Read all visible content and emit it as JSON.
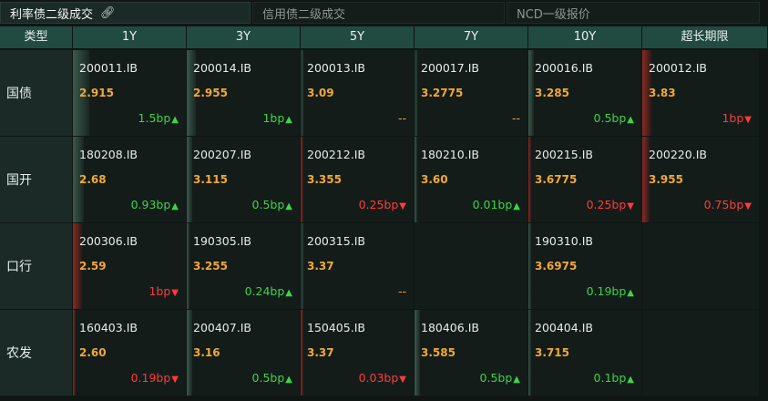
{
  "tabs": [
    {
      "label": "利率债二级成交",
      "active": true,
      "icon": "link-icon"
    },
    {
      "label": "信用债二级成交",
      "active": false
    },
    {
      "label": "NCD一级报价",
      "active": false
    }
  ],
  "columns": [
    "类型",
    "1Y",
    "3Y",
    "5Y",
    "7Y",
    "10Y",
    "超长期限"
  ],
  "colors": {
    "up": "#3ed34a",
    "down": "#ff3b3b",
    "yield": "#f0a93a",
    "header": "#214a40"
  },
  "rows": [
    {
      "label": "国债",
      "cells": [
        {
          "code": "200011.IB",
          "yield": "2.915",
          "change": "1.5bp",
          "dir": "up",
          "level": 0.45
        },
        {
          "code": "200014.IB",
          "yield": "2.955",
          "change": "1bp",
          "dir": "up",
          "level": 0.25
        },
        {
          "code": "200013.IB",
          "yield": "3.09",
          "change": "--",
          "dir": "flat",
          "level": 0
        },
        {
          "code": "200017.IB",
          "yield": "3.2775",
          "change": "--",
          "dir": "flat",
          "level": 0
        },
        {
          "code": "200016.IB",
          "yield": "3.285",
          "change": "0.5bp",
          "dir": "up",
          "level": 0.15
        },
        {
          "code": "200012.IB",
          "yield": "3.83",
          "change": "1bp",
          "dir": "down",
          "level": 0.25
        }
      ]
    },
    {
      "label": "国开",
      "cells": [
        {
          "code": "180208.IB",
          "yield": "2.68",
          "change": "0.93bp",
          "dir": "up",
          "level": 0.3
        },
        {
          "code": "200207.IB",
          "yield": "3.115",
          "change": "0.5bp",
          "dir": "up",
          "level": 0.15
        },
        {
          "code": "200212.IB",
          "yield": "3.355",
          "change": "0.25bp",
          "dir": "down",
          "level": 0.08
        },
        {
          "code": "180210.IB",
          "yield": "3.60",
          "change": "0.01bp",
          "dir": "up",
          "level": 0.02
        },
        {
          "code": "200215.IB",
          "yield": "3.6775",
          "change": "0.25bp",
          "dir": "down",
          "level": 0.08
        },
        {
          "code": "200220.IB",
          "yield": "3.955",
          "change": "0.75bp",
          "dir": "down",
          "level": 0.2
        }
      ]
    },
    {
      "label": "口行",
      "cells": [
        {
          "code": "200306.IB",
          "yield": "2.59",
          "change": "1bp",
          "dir": "down",
          "level": 0.25
        },
        {
          "code": "190305.IB",
          "yield": "3.255",
          "change": "0.24bp",
          "dir": "up",
          "level": 0.07
        },
        {
          "code": "200315.IB",
          "yield": "3.37",
          "change": "--",
          "dir": "flat",
          "level": 0
        },
        null,
        {
          "code": "190310.IB",
          "yield": "3.6975",
          "change": "0.19bp",
          "dir": "up",
          "level": 0.05
        },
        null
      ]
    },
    {
      "label": "农发",
      "cells": [
        {
          "code": "160403.IB",
          "yield": "2.60",
          "change": "0.19bp",
          "dir": "down",
          "level": 0.05
        },
        {
          "code": "200407.IB",
          "yield": "3.16",
          "change": "0.5bp",
          "dir": "up",
          "level": 0.15
        },
        {
          "code": "150405.IB",
          "yield": "3.37",
          "change": "0.03bp",
          "dir": "down",
          "level": 0.03
        },
        {
          "code": "180406.IB",
          "yield": "3.585",
          "change": "0.5bp",
          "dir": "up",
          "level": 0.15
        },
        {
          "code": "200404.IB",
          "yield": "3.715",
          "change": "0.1bp",
          "dir": "up",
          "level": 0.04
        },
        null
      ]
    }
  ]
}
